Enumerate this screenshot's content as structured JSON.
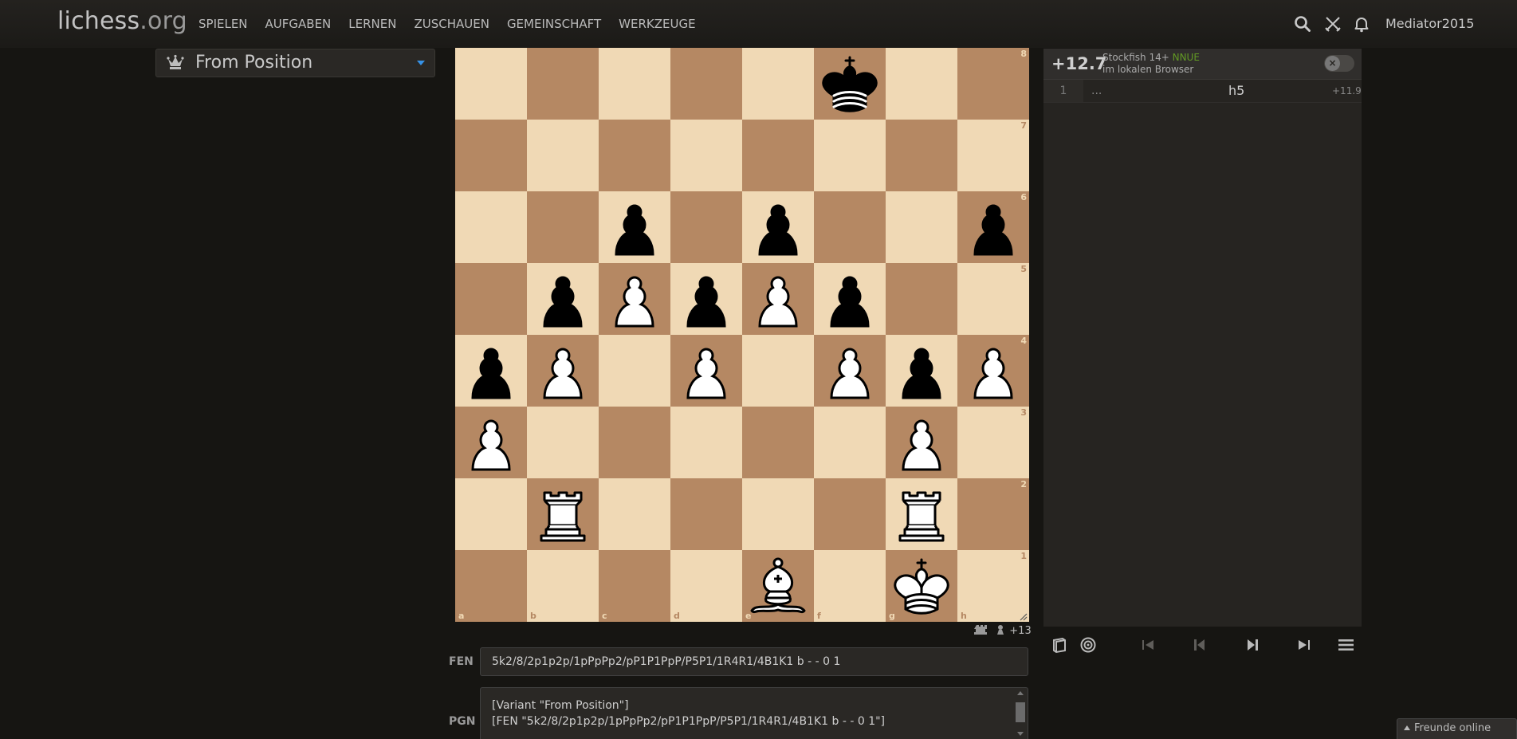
{
  "header": {
    "logo_main": "lichess",
    "logo_tld": ".org",
    "nav": [
      "SPIELEN",
      "AUFGABEN",
      "LERNEN",
      "ZUSCHAUEN",
      "GEMEINSCHAFT",
      "WERKZEUGE"
    ],
    "username": "Mediator2015",
    "icons": [
      "search-icon",
      "crossed-swords-icon",
      "bell-icon"
    ]
  },
  "variant": {
    "label": "From Position",
    "icon": "crown-icon"
  },
  "board": {
    "orientation": "white",
    "light_color": "#f0d9b5",
    "dark_color": "#b58863",
    "ranks": [
      "8",
      "7",
      "6",
      "5",
      "4",
      "3",
      "2",
      "1"
    ],
    "files": [
      "a",
      "b",
      "c",
      "d",
      "e",
      "f",
      "g",
      "h"
    ],
    "pieces": [
      {
        "square": "f8",
        "piece": "black-king"
      },
      {
        "square": "c6",
        "piece": "black-pawn"
      },
      {
        "square": "e6",
        "piece": "black-pawn"
      },
      {
        "square": "h6",
        "piece": "black-pawn"
      },
      {
        "square": "b5",
        "piece": "black-pawn"
      },
      {
        "square": "c5",
        "piece": "white-pawn"
      },
      {
        "square": "d5",
        "piece": "black-pawn"
      },
      {
        "square": "e5",
        "piece": "white-pawn"
      },
      {
        "square": "f5",
        "piece": "black-pawn"
      },
      {
        "square": "a4",
        "piece": "black-pawn"
      },
      {
        "square": "b4",
        "piece": "white-pawn"
      },
      {
        "square": "d4",
        "piece": "white-pawn"
      },
      {
        "square": "f4",
        "piece": "white-pawn"
      },
      {
        "square": "g4",
        "piece": "black-pawn"
      },
      {
        "square": "h4",
        "piece": "white-pawn"
      },
      {
        "square": "a3",
        "piece": "white-pawn"
      },
      {
        "square": "g3",
        "piece": "white-pawn"
      },
      {
        "square": "b2",
        "piece": "white-rook"
      },
      {
        "square": "g2",
        "piece": "white-rook"
      },
      {
        "square": "e1",
        "piece": "white-bishop"
      },
      {
        "square": "g1",
        "piece": "white-king"
      }
    ]
  },
  "material": {
    "advantage": "+13",
    "icons": [
      "rook-icon",
      "pawn-icon"
    ]
  },
  "fen": {
    "label": "FEN",
    "value": "5k2/8/2p1p2p/1pPpPp2/pP1P1PpP/P5P1/1R4R1/4B1K1 b - - 0 1"
  },
  "pgn": {
    "label": "PGN",
    "lines": [
      "[Variant \"From Position\"]",
      "[FEN \"5k2/8/2p1p2p/1pPpPp2/pP1P1PpP/P5P1/1R4R1/4B1K1 b - - 0 1\"]"
    ]
  },
  "engine": {
    "eval": "+12.7",
    "name": "Stockfish 14+",
    "nnue": "NNUE",
    "sub": "im lokalen Browser",
    "toggle_symbol": "×",
    "pv": {
      "number": "1",
      "dots": "...",
      "move": "h5",
      "eval": "+11.9"
    }
  },
  "controls": [
    "book-icon",
    "target-icon",
    "first-icon",
    "prev-icon",
    "next-icon",
    "last-icon",
    "menu-icon"
  ],
  "friends": {
    "label": "Freunde online"
  }
}
